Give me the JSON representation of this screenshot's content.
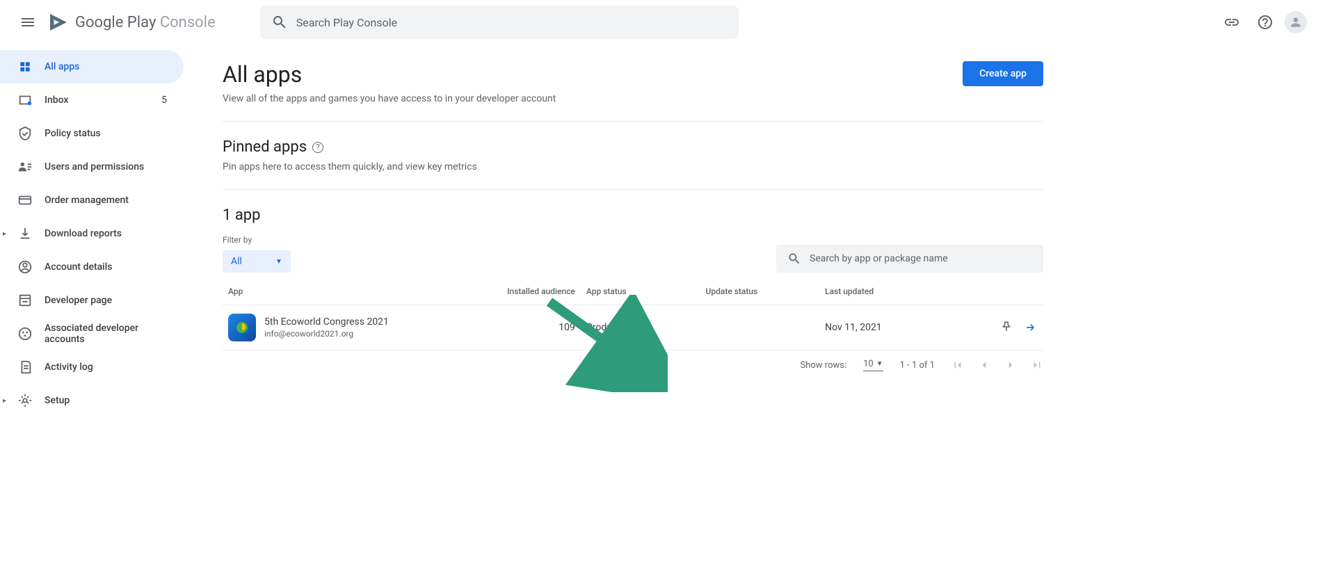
{
  "header": {
    "logo_main": "Google Play",
    "logo_sub": " Console",
    "search_placeholder": "Search Play Console"
  },
  "sidebar": {
    "items": [
      {
        "label": "All apps",
        "badge": ""
      },
      {
        "label": "Inbox",
        "badge": "5"
      },
      {
        "label": "Policy status",
        "badge": ""
      },
      {
        "label": "Users and permissions",
        "badge": ""
      },
      {
        "label": "Order management",
        "badge": ""
      },
      {
        "label": "Download reports",
        "badge": ""
      },
      {
        "label": "Account details",
        "badge": ""
      },
      {
        "label": "Developer page",
        "badge": ""
      },
      {
        "label": "Associated developer accounts",
        "badge": ""
      },
      {
        "label": "Activity log",
        "badge": ""
      },
      {
        "label": "Setup",
        "badge": ""
      }
    ]
  },
  "page": {
    "title": "All apps",
    "description": "View all of the apps and games you have access to in your developer account",
    "create_button": "Create app"
  },
  "pinned": {
    "title": "Pinned apps",
    "description": "Pin apps here to access them quickly, and view key metrics"
  },
  "apps": {
    "count_title": "1 app",
    "filter_label": "Filter by",
    "filter_value": "All",
    "search_placeholder": "Search by app or package name",
    "columns": {
      "app": "App",
      "installed": "Installed audience",
      "status": "App status",
      "update": "Update status",
      "updated": "Last updated"
    },
    "rows": [
      {
        "name": "5th Ecoworld Congress 2021",
        "email": "info@ecoworld2021.org",
        "installed": "109",
        "status": "Production",
        "update": "",
        "updated": "Nov 11, 2021"
      }
    ]
  },
  "pagination": {
    "show_label": "Show rows:",
    "rows": "10",
    "range": "1 - 1 of 1"
  }
}
